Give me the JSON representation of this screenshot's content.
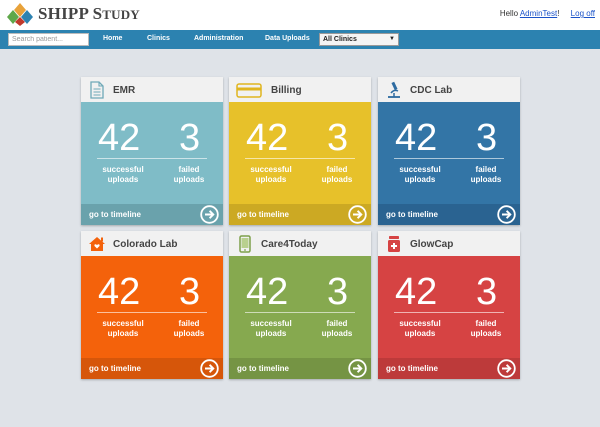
{
  "brand": {
    "big": "SHIPP",
    "small_s": "S",
    "small_rest": "TUDY"
  },
  "user": {
    "greeting": "Hello ",
    "name": "AdminTest",
    "bang": "!",
    "logoff": "Log off"
  },
  "search": {
    "placeholder": "Search patient..."
  },
  "nav": {
    "home": "Home",
    "clinics": "Clinics",
    "administration": "Administration",
    "data_uploads": "Data Uploads"
  },
  "clinic_filter": {
    "selected": "All Clinics",
    "arrow": "▼"
  },
  "colors": {
    "navbar": "#2c82b0",
    "emr": "#7fbcc7",
    "billing": "#e7c12a",
    "cdc": "#3375a6",
    "colorado": "#f4620b",
    "care4today": "#86a94f",
    "glowcap": "#d64343"
  },
  "cards": [
    {
      "title": "EMR",
      "icon": "document-icon",
      "successful": "42",
      "failed": "3",
      "successful_label": "successful uploads",
      "failed_label": "failed uploads",
      "timeline": "go to timeline"
    },
    {
      "title": "Billing",
      "icon": "credit-card-icon",
      "successful": "42",
      "failed": "3",
      "successful_label": "successful uploads",
      "failed_label": "failed uploads",
      "timeline": "go to timeline"
    },
    {
      "title": "CDC Lab",
      "icon": "microscope-icon",
      "successful": "42",
      "failed": "3",
      "successful_label": "successful uploads",
      "failed_label": "failed uploads",
      "timeline": "go to timeline"
    },
    {
      "title": "Colorado Lab",
      "icon": "house-icon",
      "successful": "42",
      "failed": "3",
      "successful_label": "successful uploads",
      "failed_label": "failed uploads",
      "timeline": "go to timeline"
    },
    {
      "title": "Care4Today",
      "icon": "phone-icon",
      "successful": "42",
      "failed": "3",
      "successful_label": "successful uploads",
      "failed_label": "failed uploads",
      "timeline": "go to timeline"
    },
    {
      "title": "GlowCap",
      "icon": "pill-bottle-icon",
      "successful": "42",
      "failed": "3",
      "successful_label": "successful uploads",
      "failed_label": "failed uploads",
      "timeline": "go to timeline"
    }
  ]
}
